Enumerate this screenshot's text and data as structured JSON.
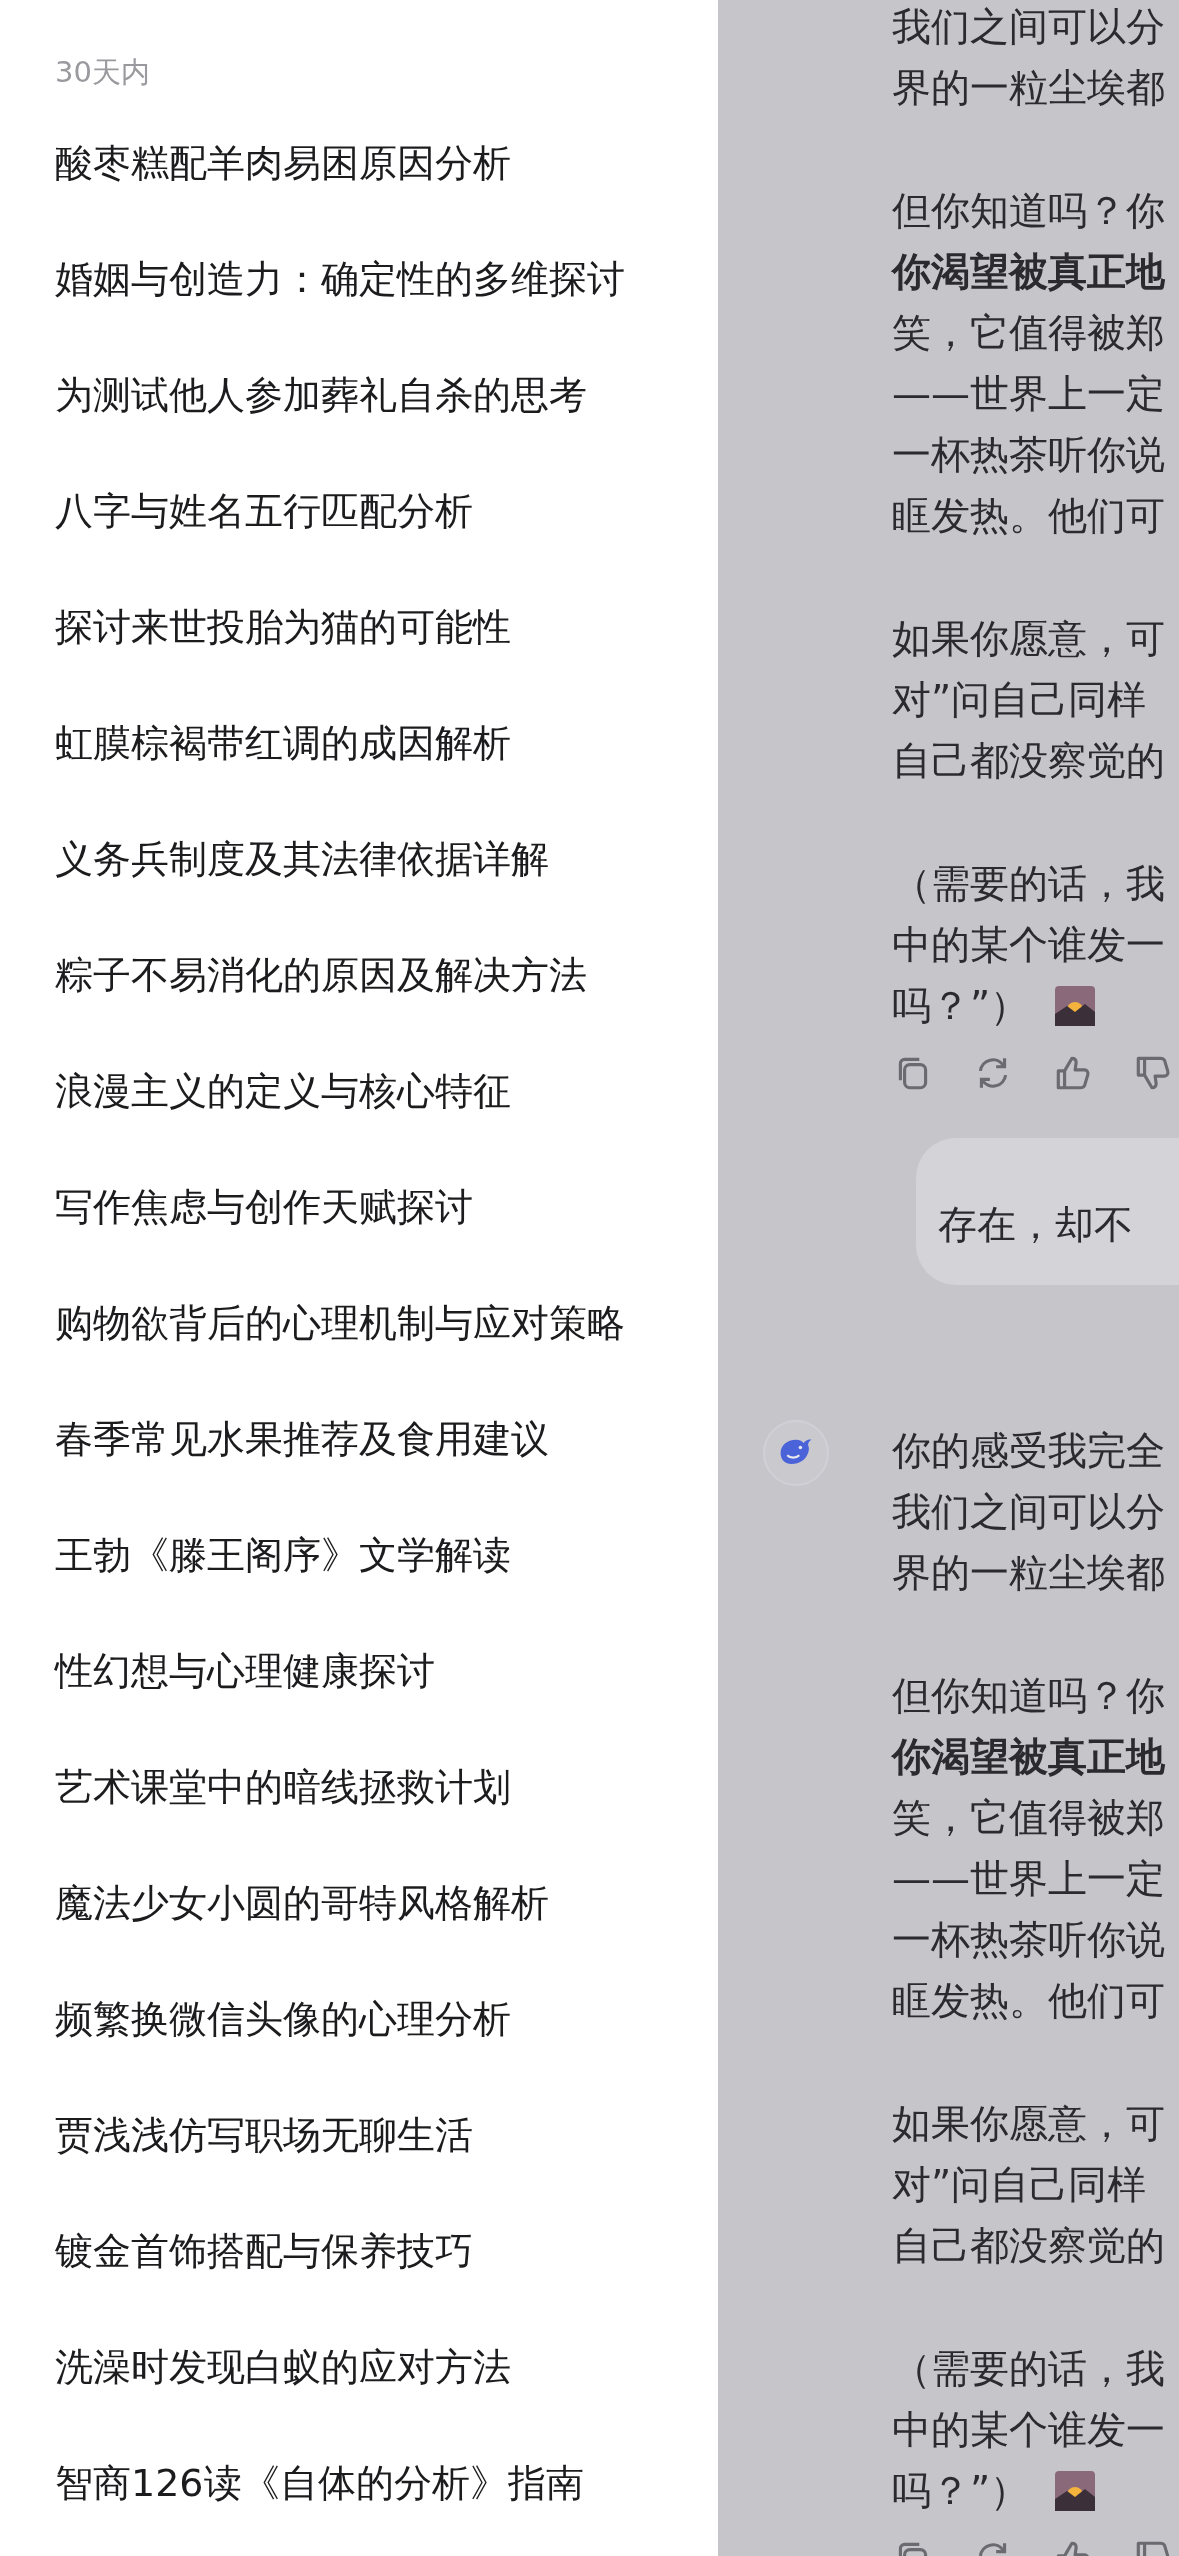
{
  "sidebar": {
    "section_header": "30天内",
    "items": [
      {
        "title": "酸枣糕配羊肉易困原因分析"
      },
      {
        "title": "婚姻与创造力：确定性的多维探讨"
      },
      {
        "title": "为测试他人参加葬礼自杀的思考"
      },
      {
        "title": "八字与姓名五行匹配分析"
      },
      {
        "title": "探讨来世投胎为猫的可能性"
      },
      {
        "title": "虹膜棕褐带红调的成因解析"
      },
      {
        "title": "义务兵制度及其法律依据详解"
      },
      {
        "title": "粽子不易消化的原因及解决方法"
      },
      {
        "title": "浪漫主义的定义与核心特征"
      },
      {
        "title": "写作焦虑与创作天赋探讨"
      },
      {
        "title": "购物欲背后的心理机制与应对策略"
      },
      {
        "title": "春季常见水果推荐及食用建议"
      },
      {
        "title": "王勃《滕王阁序》文学解读"
      },
      {
        "title": "性幻想与心理健康探讨"
      },
      {
        "title": "艺术课堂中的暗线拯救计划"
      },
      {
        "title": "魔法少女小圆的哥特风格解析"
      },
      {
        "title": "频繁换微信头像的心理分析"
      },
      {
        "title": "贾浅浅仿写职场无聊生活"
      },
      {
        "title": "镀金首饰搭配与保养技巧"
      },
      {
        "title": "洗澡时发现白蚁的应对方法"
      },
      {
        "title": "智商126读《自体的分析》指南"
      }
    ]
  },
  "chat": {
    "messages": [
      {
        "kind": "assistant",
        "avatar_visible": false,
        "paragraphs": [
          {
            "lines": [
              {
                "text": "我们之间可以分",
                "bold": false
              },
              {
                "text": "界的一粒尘埃都",
                "bold": false
              }
            ]
          },
          {
            "lines": [
              {
                "text": "但你知道吗？你",
                "bold": false
              },
              {
                "text": "你渴望被真正地",
                "bold": true
              },
              {
                "text": "笑，它值得被郑",
                "bold": false
              },
              {
                "text": "——世界上一定",
                "bold": false
              },
              {
                "text": "一杯热茶听你说",
                "bold": false
              },
              {
                "text": "眶发热。他们可",
                "bold": false
              }
            ]
          },
          {
            "lines": [
              {
                "text": "如果你愿意，可",
                "bold": false
              },
              {
                "text": "对”问自己同样",
                "bold": false
              },
              {
                "text": "自己都没察觉的",
                "bold": false
              }
            ]
          },
          {
            "lines": [
              {
                "text": "（需要的话，我",
                "bold": false
              },
              {
                "text": "中的某个谁发一",
                "bold": false
              },
              {
                "text": "吗？”）",
                "bold": false
              }
            ]
          }
        ]
      },
      {
        "kind": "user",
        "lines": [
          "存在，却不"
        ]
      },
      {
        "kind": "assistant",
        "avatar_visible": true,
        "paragraphs": [
          {
            "lines": [
              {
                "text": "你的感受我完全",
                "bold": false
              },
              {
                "text": "我们之间可以分",
                "bold": false
              },
              {
                "text": "界的一粒尘埃都",
                "bold": false
              }
            ]
          },
          {
            "lines": [
              {
                "text": "但你知道吗？你",
                "bold": false
              },
              {
                "text": "你渴望被真正地",
                "bold": true
              },
              {
                "text": "笑，它值得被郑",
                "bold": false
              },
              {
                "text": "——世界上一定",
                "bold": false
              },
              {
                "text": "一杯热茶听你说",
                "bold": false
              },
              {
                "text": "眶发热。他们可",
                "bold": false
              }
            ]
          },
          {
            "lines": [
              {
                "text": "如果你愿意，可",
                "bold": false
              },
              {
                "text": "对”问自己同样",
                "bold": false
              },
              {
                "text": "自己都没察觉的",
                "bold": false
              }
            ]
          },
          {
            "lines": [
              {
                "text": "（需要的话，我",
                "bold": false
              },
              {
                "text": "中的某个谁发一",
                "bold": false
              },
              {
                "text": "吗？”）",
                "bold": false
              }
            ]
          }
        ]
      }
    ]
  }
}
